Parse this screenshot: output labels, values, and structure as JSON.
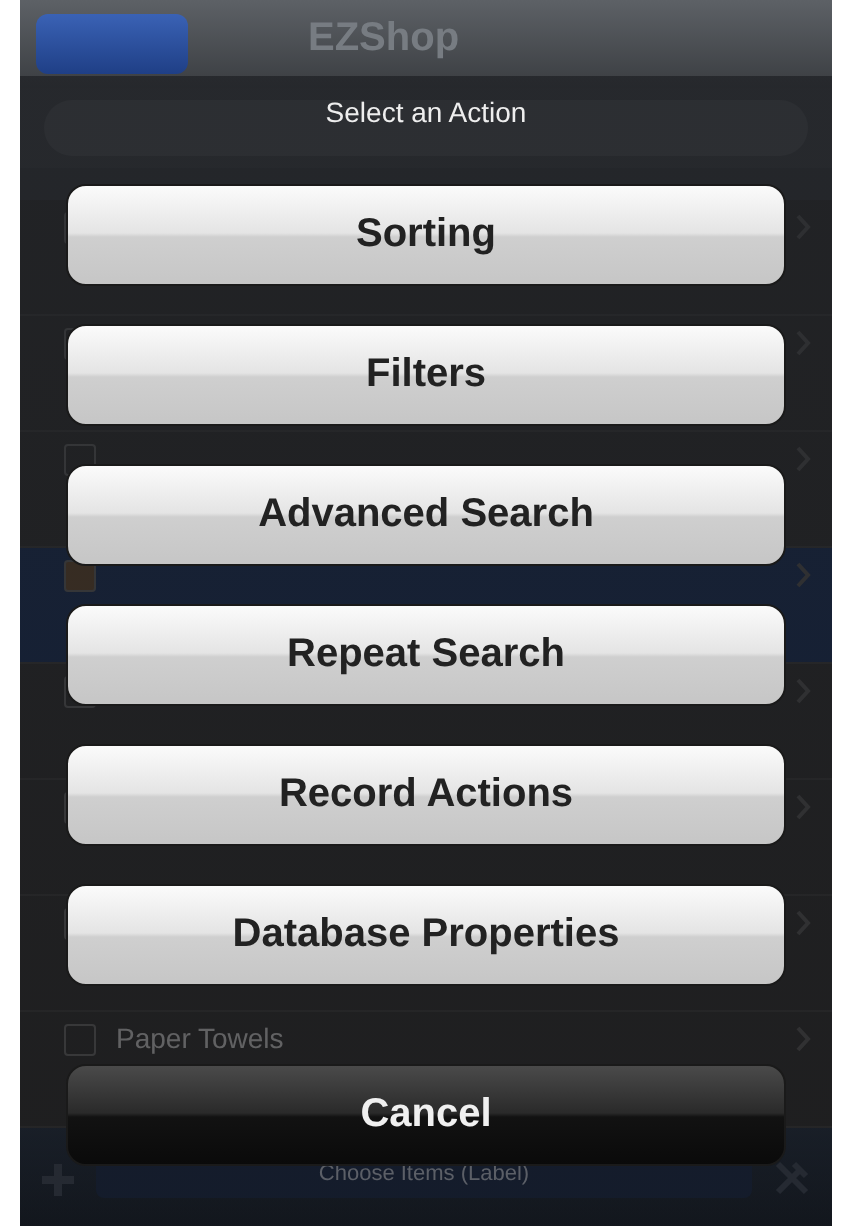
{
  "nav": {
    "title": "EZShop"
  },
  "list": {
    "rows": [
      {
        "selected": false
      },
      {
        "selected": false
      },
      {
        "selected": false
      },
      {
        "selected": true
      },
      {
        "selected": false
      },
      {
        "selected": false
      },
      {
        "selected": false
      },
      {
        "label": "Paper Towels",
        "selected": false
      }
    ]
  },
  "toolbar": {
    "center": "Choose Items (Label)"
  },
  "action_sheet": {
    "title": "Select an Action",
    "actions": [
      {
        "label": "Sorting",
        "kind": "default"
      },
      {
        "label": "Filters",
        "kind": "default"
      },
      {
        "label": "Advanced Search",
        "kind": "default"
      },
      {
        "label": "Repeat Search",
        "kind": "default"
      },
      {
        "label": "Record Actions",
        "kind": "default"
      },
      {
        "label": "Database Properties",
        "kind": "default"
      },
      {
        "label": "Cancel",
        "kind": "cancel"
      }
    ]
  }
}
